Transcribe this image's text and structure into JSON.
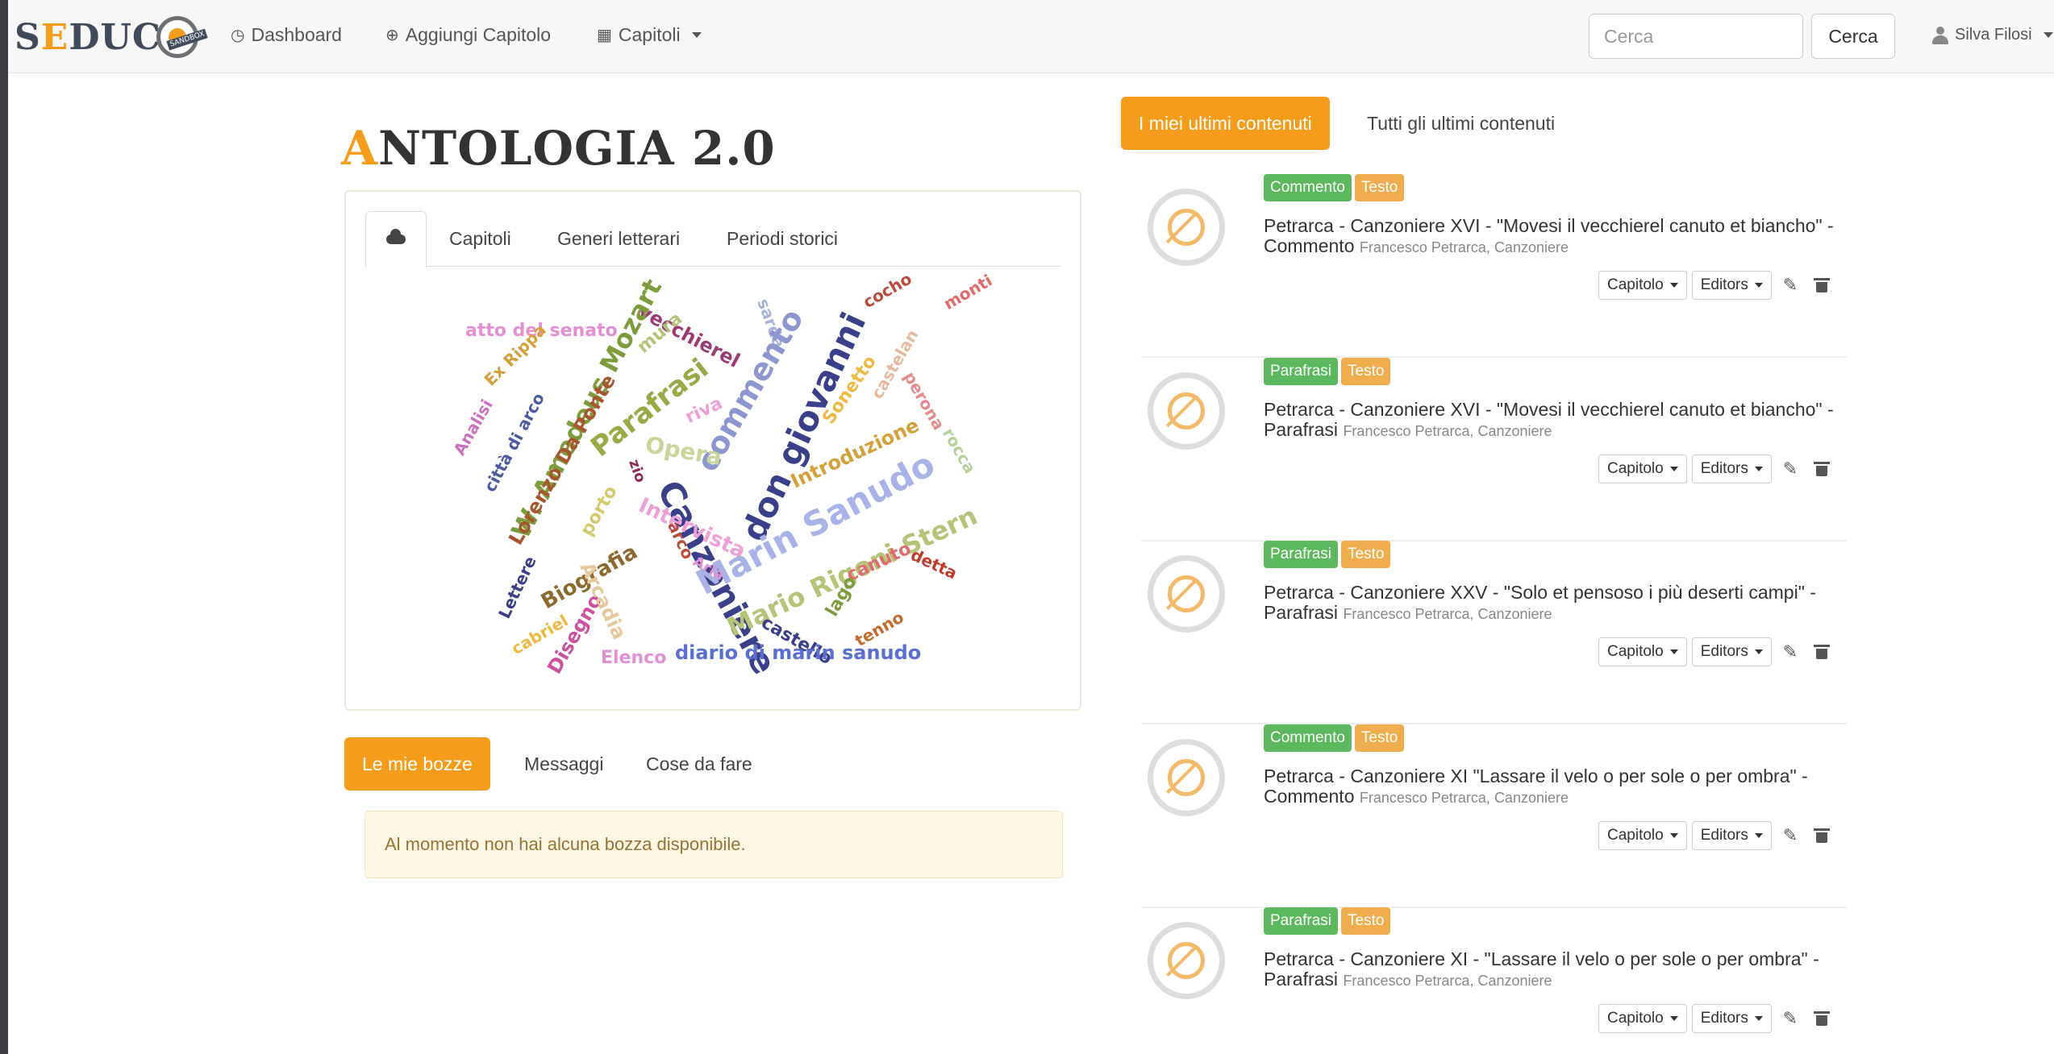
{
  "brand": {
    "left": "S",
    "orange": "E",
    "rest": "DUC",
    "badge": "SANDBOX"
  },
  "nav": {
    "dashboard": "Dashboard",
    "add_chapter": "Aggiungi Capitolo",
    "chapters": "Capitoli"
  },
  "search": {
    "placeholder": "Cerca",
    "button": "Cerca"
  },
  "user": {
    "name": "Silva Filosi"
  },
  "page": {
    "title_first": "A",
    "title_rest": "NTOLOGIA 2.0"
  },
  "cloud_tabs": [
    "Capitoli",
    "Generi letterari",
    "Periodi storici"
  ],
  "wordcloud": [
    {
      "text": "atto del senato",
      "color": "#e38fd4"
    },
    {
      "text": "vecchierel",
      "color": "#9c3a76"
    },
    {
      "text": "sarda",
      "color": "#a7b3d9"
    },
    {
      "text": "cocho",
      "color": "#b94a3c"
    },
    {
      "text": "monti",
      "color": "#e06b6b"
    },
    {
      "text": "Ex Rippa",
      "color": "#d4a039"
    },
    {
      "text": "W. Amedeus Mozart",
      "color": "#7d9d3c"
    },
    {
      "text": "mura",
      "color": "#b3c476"
    },
    {
      "text": "Parafrasi",
      "color": "#9aa845"
    },
    {
      "text": "commento",
      "color": "#8c96cf"
    },
    {
      "text": "don giovanni",
      "color": "#3a3f8a"
    },
    {
      "text": "Sonetto",
      "color": "#f0b840"
    },
    {
      "text": "castelan",
      "color": "#e6b9a0"
    },
    {
      "text": "perona",
      "color": "#e68989"
    },
    {
      "text": "Analisi",
      "color": "#cc6fc0"
    },
    {
      "text": "città di arco",
      "color": "#4a5aa0"
    },
    {
      "text": "Lorenzo Da Ponte",
      "color": "#a8542d"
    },
    {
      "text": "Opera",
      "color": "#c9d49b"
    },
    {
      "text": "riva",
      "color": "#ee9fd8"
    },
    {
      "text": "Introduzione",
      "color": "#d4a039"
    },
    {
      "text": "rocca",
      "color": "#b3d39b"
    },
    {
      "text": "zio",
      "color": "#8a2a5a"
    },
    {
      "text": "Canzoniere",
      "color": "#3a3f8a"
    },
    {
      "text": "porto",
      "color": "#d4c96b"
    },
    {
      "text": "Intervista",
      "color": "#ee9fd8"
    },
    {
      "text": "Marin Sanudo",
      "color": "#a7b3e6"
    },
    {
      "text": "Mario Rigoni Stern",
      "color": "#b3c476"
    },
    {
      "text": "arco",
      "color": "#b94a3c"
    },
    {
      "text": "Aria",
      "color": "#e38fd4"
    },
    {
      "text": "canuto",
      "color": "#e06b6b"
    },
    {
      "text": "detta",
      "color": "#c0392b"
    },
    {
      "text": "Biografia",
      "color": "#8c6a2d"
    },
    {
      "text": "Lettere",
      "color": "#3a3f8a"
    },
    {
      "text": "cabriel",
      "color": "#f0b840"
    },
    {
      "text": "Disegno",
      "color": "#cc4fa0"
    },
    {
      "text": "Arcadia",
      "color": "#e6c89a"
    },
    {
      "text": "Elenco",
      "color": "#e38fd4"
    },
    {
      "text": "castello",
      "color": "#3a3f8a"
    },
    {
      "text": "lago",
      "color": "#7d9d3c"
    },
    {
      "text": "tenno",
      "color": "#c46a2d"
    },
    {
      "text": "diario di marin sanudo",
      "color": "#5a6fd0"
    }
  ],
  "bottom_tabs": [
    "Le mie bozze",
    "Messaggi",
    "Cose da fare"
  ],
  "alert": "Al momento non hai alcuna bozza disponibile.",
  "right_tabs": [
    "I miei ultimi contenuti",
    "Tutti gli ultimi contenuti"
  ],
  "feed": [
    {
      "tag1": "Commento",
      "tag2": "Testo",
      "title": "Petrarca - Canzoniere XVI - \"Movesi il vecchierel canuto et biancho\" - Commento",
      "meta": "Francesco Petrarca, Canzoniere"
    },
    {
      "tag1": "Parafrasi",
      "tag2": "Testo",
      "title": "Petrarca - Canzoniere XVI - \"Movesi il vecchierel canuto et biancho\" - Parafrasi",
      "meta": "Francesco Petrarca, Canzoniere"
    },
    {
      "tag1": "Parafrasi",
      "tag2": "Testo",
      "title": "Petrarca - Canzoniere XXV - \"Solo et pensoso i più deserti campi\" - Parafrasi",
      "meta": "Francesco Petrarca, Canzoniere"
    },
    {
      "tag1": "Commento",
      "tag2": "Testo",
      "title": "Petrarca - Canzoniere XI \"Lassare il velo o per sole o per ombra\" - Commento",
      "meta": "Francesco Petrarca, Canzoniere"
    },
    {
      "tag1": "Parafrasi",
      "tag2": "Testo",
      "title": "Petrarca - Canzoniere XI - \"Lassare il velo o per sole o per ombra\" - Parafrasi",
      "meta": "Francesco Petrarca, Canzoniere"
    }
  ],
  "feed_actions": {
    "capitolo": "Capitolo",
    "editors": "Editors"
  },
  "colors": {
    "accent": "#f59c1a",
    "green": "#5cb85c",
    "orange": "#f0ad4e"
  }
}
